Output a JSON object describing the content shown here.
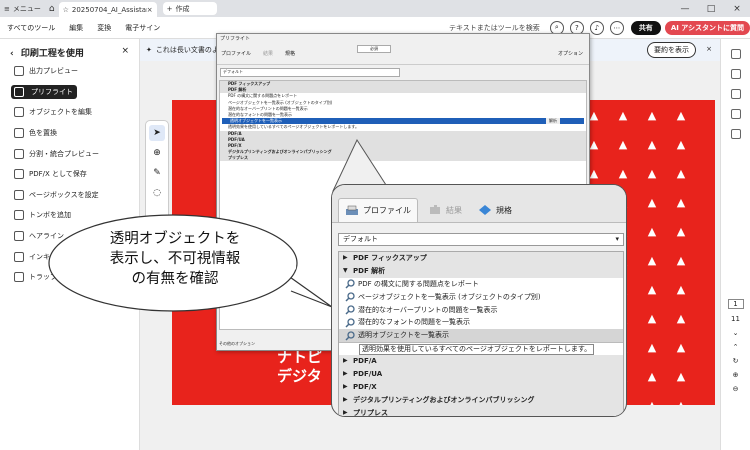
{
  "browser": {
    "menu_label": "メニュー",
    "tab_title": "20250704_AI_Assistan...",
    "new_tab_label": "作成",
    "close_glyph": "×",
    "minimize_glyph": "—",
    "maximize_glyph": "□"
  },
  "menubar": {
    "items": [
      "すべてのツール",
      "編集",
      "変換",
      "電子サイン"
    ],
    "search_placeholder": "テキストまたはツールを検索",
    "share_label": "共有",
    "ai_label": "AI アシスタントに質問"
  },
  "left_panel": {
    "title": "印刷工程を使用",
    "close_glyph": "×",
    "items": [
      {
        "label": "出力プレビュー"
      },
      {
        "label": "プリフライト"
      },
      {
        "label": "オブジェクトを編集"
      },
      {
        "label": "色を置換"
      },
      {
        "label": "分割・統合プレビュー"
      },
      {
        "label": "PDF/X として保存"
      },
      {
        "label": "ページボックスを設定"
      },
      {
        "label": "トンボを追加"
      },
      {
        "label": "ヘアライン"
      },
      {
        "label": "インキ"
      },
      {
        "label": "トラッププリ"
      }
    ]
  },
  "notification": {
    "text": "これは長い文書のよ",
    "button_label": "要約を表示"
  },
  "document": {
    "page_text_lines": [
      "ナトピ",
      "デジタ"
    ]
  },
  "right_rail": {
    "page_current": "1",
    "page_total": "11"
  },
  "preflight_small": {
    "title": "プリフライト",
    "tabs": [
      "プロファイル",
      "結果",
      "規格"
    ],
    "select_value": "必須",
    "options_label": "オプション",
    "profile_select": "デフォルト",
    "rows": [
      {
        "kind": "grp",
        "label": "PDF フィックスアップ"
      },
      {
        "kind": "grp",
        "label": "PDF 解析"
      },
      {
        "kind": "item",
        "label": "PDF の構文に関する問題点をレポート"
      },
      {
        "kind": "item",
        "label": "ページオブジェクトを一覧表示 (オブジェクトのタイプ別)"
      },
      {
        "kind": "item",
        "label": "潜在的なオーバープリントの問題を一覧表示"
      },
      {
        "kind": "item",
        "label": "潜在的なフォントの問題を一覧表示"
      },
      {
        "kind": "hl",
        "label": "透明オブジェクトを一覧表示"
      },
      {
        "kind": "item",
        "label": "透明効果を使用しているすべてのページオブジェクトをレポートします。"
      },
      {
        "kind": "grp",
        "label": "PDF/A"
      },
      {
        "kind": "grp",
        "label": "PDF/UA"
      },
      {
        "kind": "grp",
        "label": "PDF/X"
      },
      {
        "kind": "grp",
        "label": "デジタルプリンティングおよびオンラインパブリッシング"
      },
      {
        "kind": "grp",
        "label": "プリプレス"
      }
    ],
    "run_label": "解析",
    "bottom_label": "その他のオプション"
  },
  "zoom": {
    "tabs": [
      "プロファイル",
      "結果",
      "規格"
    ],
    "profile_select": "デフォルト",
    "rows": [
      {
        "kind": "grp",
        "label": "PDF フィックスアップ",
        "open": false
      },
      {
        "kind": "grp",
        "label": "PDF 解析",
        "open": true
      },
      {
        "kind": "item",
        "label": "PDF の構文に関する問題点をレポート"
      },
      {
        "kind": "item",
        "label": "ページオブジェクトを一覧表示 (オブジェクトのタイプ別)"
      },
      {
        "kind": "item",
        "label": "潜在的なオーバープリントの問題を一覧表示"
      },
      {
        "kind": "item",
        "label": "潜在的なフォントの問題を一覧表示"
      },
      {
        "kind": "hl",
        "label": "透明オブジェクトを一覧表示"
      },
      {
        "kind": "desc",
        "label": "透明効果を使用しているすべてのページオブジェクトをレポートします。"
      },
      {
        "kind": "grp",
        "label": "PDF/A",
        "open": false
      },
      {
        "kind": "grp",
        "label": "PDF/UA",
        "open": false
      },
      {
        "kind": "grp",
        "label": "PDF/X",
        "open": false
      },
      {
        "kind": "grp",
        "label": "デジタルプリンティングおよびオンラインパブリッシング",
        "open": false
      },
      {
        "kind": "grp",
        "label": "プリプレス",
        "open": false
      }
    ]
  },
  "callout": {
    "lines": [
      "透明オブジェクトを",
      "表示し、不可視情報",
      "の有無を確認"
    ]
  },
  "colors": {
    "accent_red": "#e8231c",
    "highlight_blue": "#1f5fb8",
    "ai_button": "#e34850"
  }
}
